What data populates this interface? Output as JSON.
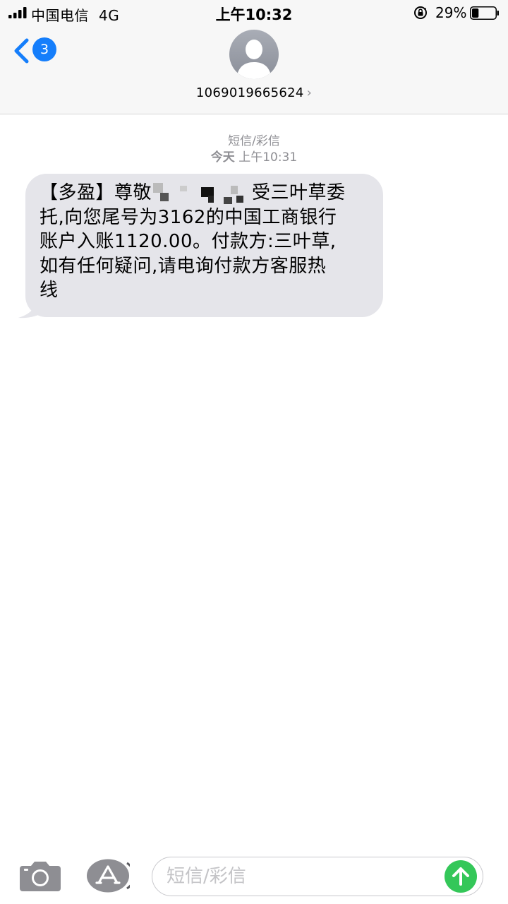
{
  "status_bar": {
    "carrier": "中国电信",
    "network": "4G",
    "time": "上午10:32",
    "battery_percent": "29%",
    "battery_level": 0.29
  },
  "nav": {
    "unread_count": "3",
    "contact": "1069019665624",
    "contact_chevron": "›"
  },
  "conversation": {
    "message_type": "短信/彩信",
    "day": "今天",
    "time": "上午10:31",
    "messages": [
      {
        "direction": "incoming",
        "lines": [
          "【多盈】尊敬",
          "受三叶草委",
          "托,向您尾号为",
          "3162的中国工商银行",
          "账户入账1120.00。付款方:三叶草,",
          "如有任何疑问,请电询付款方客服热",
          "线"
        ]
      }
    ]
  },
  "composer": {
    "placeholder": "短信/彩信"
  },
  "colors": {
    "accent": "#157efb",
    "send": "#34c759",
    "bubble": "#e5e5ea",
    "meta": "#8e8e93"
  },
  "icons": [
    "back-chevron-icon",
    "camera-icon",
    "app-store-icon",
    "send-arrow-icon",
    "rotation-lock-icon",
    "battery-icon",
    "signal-icon"
  ]
}
